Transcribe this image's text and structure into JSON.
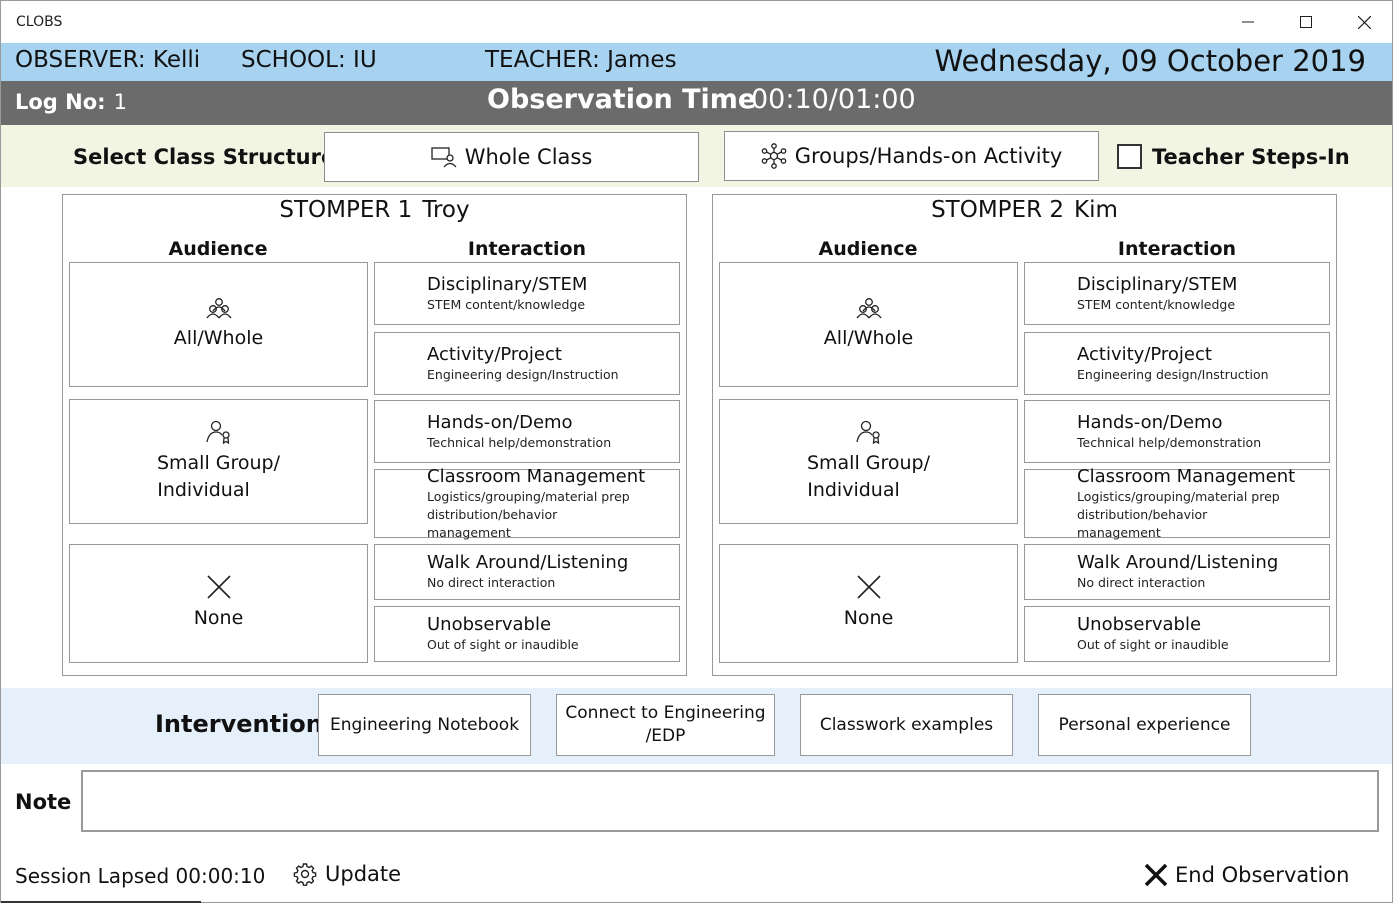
{
  "window": {
    "title": "CLOBS"
  },
  "info": {
    "observer": "OBSERVER: Kelli",
    "school": "SCHOOL: IU",
    "teacher": "TEACHER: James",
    "date": "Wednesday, 09 October 2019"
  },
  "timebar": {
    "log_label": "Log No:",
    "log_number": "1",
    "obs_label": "Observation Time",
    "obs_value": "00:10/01:00"
  },
  "structure": {
    "label": "Select Class Structure",
    "whole_class": "Whole Class",
    "groups": "Groups/Hands-on Activity",
    "teacher_steps_in": "Teacher Steps-In"
  },
  "stompers": [
    {
      "title": "STOMPER 1",
      "name": "Troy",
      "audience_head": "Audience",
      "interaction_head": "Interaction",
      "audience": {
        "all": "All/Whole",
        "small_1": "Small Group/",
        "small_2": "Individual",
        "none": "None"
      },
      "interactions": [
        {
          "title": "Disciplinary/STEM",
          "sub": "STEM content/knowledge"
        },
        {
          "title": "Activity/Project",
          "sub": "Engineering design/Instruction"
        },
        {
          "title": "Hands-on/Demo",
          "sub": "Technical help/demonstration"
        },
        {
          "title": "Classroom Management",
          "sub": "Logistics/grouping/material prep distribution/behavior management"
        },
        {
          "title": "Walk Around/Listening",
          "sub": "No direct interaction"
        },
        {
          "title": "Unobservable",
          "sub": "Out of sight or inaudible"
        }
      ]
    },
    {
      "title": "STOMPER 2",
      "name": "Kim",
      "audience_head": "Audience",
      "interaction_head": "Interaction",
      "audience": {
        "all": "All/Whole",
        "small_1": "Small Group/",
        "small_2": "Individual",
        "none": "None"
      },
      "interactions": [
        {
          "title": "Disciplinary/STEM",
          "sub": "STEM content/knowledge"
        },
        {
          "title": "Activity/Project",
          "sub": "Engineering design/Instruction"
        },
        {
          "title": "Hands-on/Demo",
          "sub": "Technical help/demonstration"
        },
        {
          "title": "Classroom Management",
          "sub": "Logistics/grouping/material prep distribution/behavior management"
        },
        {
          "title": "Walk Around/Listening",
          "sub": "No direct interaction"
        },
        {
          "title": "Unobservable",
          "sub": "Out of sight or inaudible"
        }
      ]
    }
  ],
  "interventions": {
    "label": "Interventions",
    "items": [
      "Engineering Notebook",
      "Connect to Engineering /EDP",
      "Classwork examples",
      "Personal experience"
    ],
    "connect_line1": "Connect to Engineering",
    "connect_line2": "/EDP"
  },
  "note": {
    "label": "Note",
    "value": ""
  },
  "footer": {
    "session": "Session Lapsed 00:00:10",
    "update": "Update",
    "end": "End Observation"
  },
  "icons": {
    "whole_class": "presenter-icon",
    "groups": "network-icon",
    "all_whole": "group-people-icon",
    "small_group": "person-badge-icon",
    "none": "x-icon",
    "update": "gear-icon",
    "end": "close-icon"
  }
}
